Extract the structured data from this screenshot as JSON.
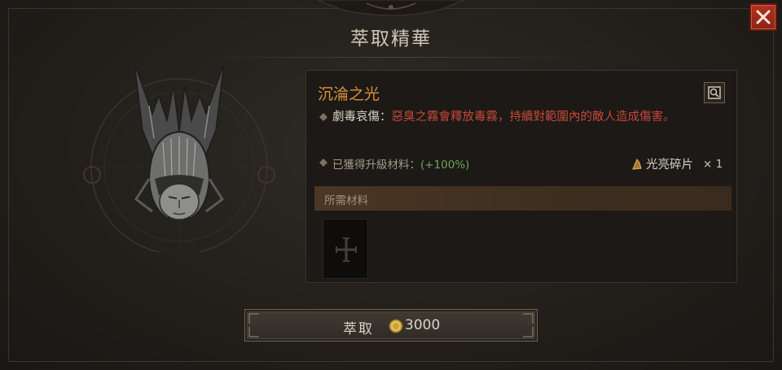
{
  "window": {
    "title": "萃取精華"
  },
  "aspect": {
    "name": "沉淪之光",
    "effect_name": "劇毒哀傷",
    "effect_separator": "：",
    "effect_text": "惡臭之霧會釋放毒霧，持續對範圍內的敵人造成傷害。",
    "upgrade_label": "已獲得升級材料：",
    "upgrade_percent": "(+100%)",
    "reward_item": "光亮碎片",
    "reward_qty": "× 1"
  },
  "materials": {
    "header": "所需材料"
  },
  "extract": {
    "label": "萃取",
    "cost": "3000"
  },
  "icons": {
    "close": "close-icon",
    "codex": "codex-icon",
    "helm": "helm-icon",
    "coin": "gold-coin-icon",
    "shard": "shard-icon",
    "slot": "cross-icon"
  },
  "colors": {
    "aspect_name": "#d9913c",
    "effect_text": "#c7473a",
    "upgrade_percent": "#6fa755",
    "close_button": "#b2321f"
  }
}
